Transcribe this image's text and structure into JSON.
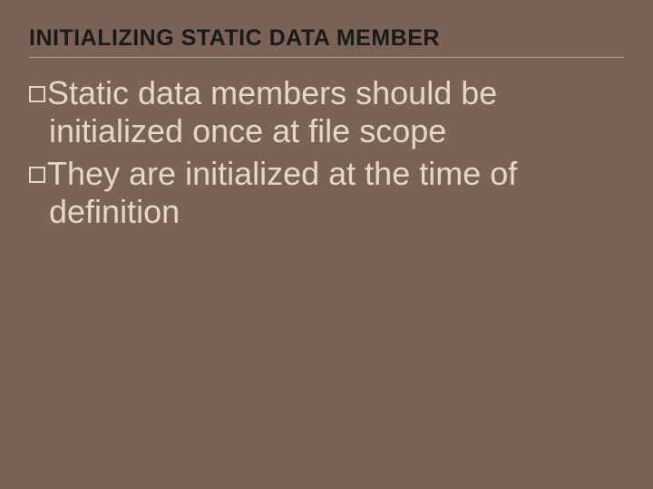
{
  "title": "INITIALIZING STATIC DATA MEMBER",
  "bullets": [
    "Static data members should be initialized once at file scope",
    "They are initialized at the time of definition"
  ]
}
